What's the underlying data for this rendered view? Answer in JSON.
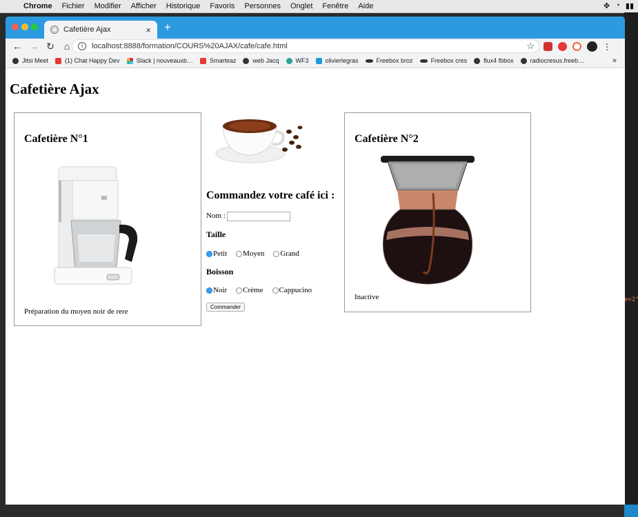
{
  "menubar": {
    "app": "Chrome",
    "items": [
      "Fichier",
      "Modifier",
      "Afficher",
      "Historique",
      "Favoris",
      "Personnes",
      "Onglet",
      "Fenêtre",
      "Aide"
    ]
  },
  "tab": {
    "title": "Cafetière Ajax",
    "close": "×",
    "new_tab": "+"
  },
  "address": {
    "url": "localhost:8888/formation/COURS%20AJAX/cafe/cafe.html"
  },
  "bookmarks": [
    "Jitsi Meet",
    "(1) Chat Happy Dev",
    "Slack | nouveauxb…",
    "Smarteaz",
    "web Jacq",
    "WF3",
    "olivierlegras",
    "Freebox broz",
    "Freebox cres",
    "flux4 fbbox",
    "radiocresus.freeb…"
  ],
  "bookmarks_more": "»",
  "page": {
    "title": "Cafetière Ajax",
    "machine1": {
      "title": "Cafetière N°1",
      "status": "Préparation du moyen noir de rere"
    },
    "machine2": {
      "title": "Cafetière N°2",
      "status": "Inactive"
    },
    "order": {
      "heading": "Commandez votre café ici :",
      "name_label": "Nom :",
      "name_value": "",
      "size_label": "Taille",
      "sizes": [
        "Petit",
        "Moyen",
        "Grand"
      ],
      "size_selected": "Petit",
      "drink_label": "Boisson",
      "drinks": [
        "Noir",
        "Crème",
        "Cappucino"
      ],
      "drink_selected": "Noir",
      "submit": "Commander"
    }
  },
  "colors": {
    "tabbar": "#2b9ae0",
    "radio_selected": "#3aa0f0"
  },
  "side_code": "e=2\""
}
